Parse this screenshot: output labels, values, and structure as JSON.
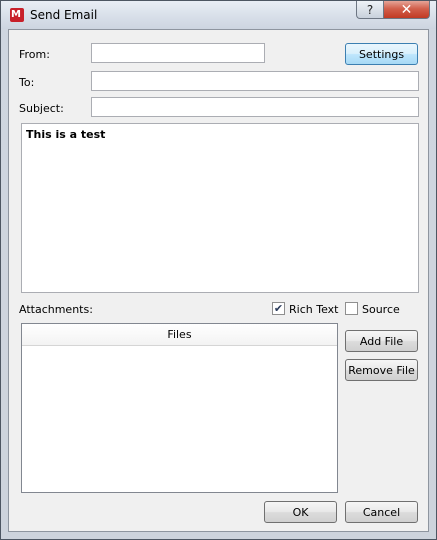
{
  "window": {
    "title": "Send Email",
    "app_icon_letter": "M",
    "help_label": "?",
    "close_label": "✕"
  },
  "form": {
    "from_label": "From:",
    "from_value": "",
    "to_label": "To:",
    "to_value": "",
    "subject_label": "Subject:",
    "subject_value": "",
    "settings_label": "Settings",
    "body_text": "This is a test"
  },
  "attachments": {
    "label": "Attachments:",
    "rich_text_label": "Rich Text",
    "rich_text_checked": true,
    "source_label": "Source",
    "source_checked": false,
    "files_column_header": "Files",
    "files": [],
    "add_file_label": "Add File",
    "remove_file_label": "Remove File"
  },
  "footer": {
    "ok_label": "OK",
    "cancel_label": "Cancel"
  },
  "colors": {
    "close_button": "#c13a24",
    "focused_button": "#a7d9f5"
  },
  "icons": {
    "app": "app-logo-icon",
    "help": "help-icon",
    "close": "close-icon",
    "checkmark": "checkmark-icon"
  }
}
